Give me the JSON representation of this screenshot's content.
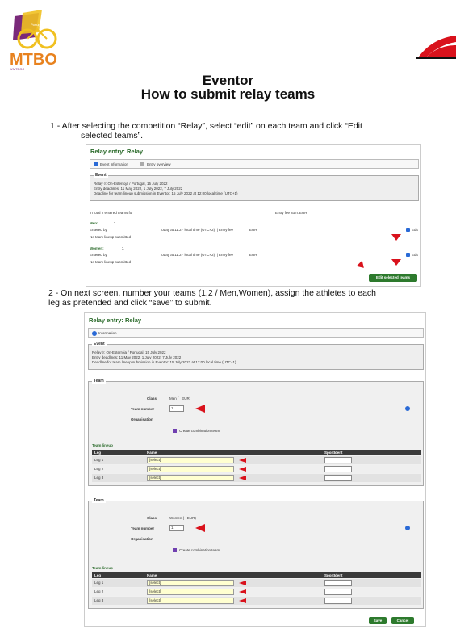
{
  "header": {
    "title": "Eventor",
    "subtitle": "How to submit relay teams"
  },
  "logo": {
    "text": "MTBO",
    "wc_text": "WMTBOC",
    "year": "2022",
    "country": "Portugal"
  },
  "step1": {
    "line1": "1 - After selecting the competition “Relay”, select “edit” on each team and click “Edit",
    "line2": "selected teams”."
  },
  "step2": {
    "line1": "2 - On next screen, number your teams (1,2 / Men,Women), assign the athletes to each",
    "line2": "leg as pretended and click “save” to submit."
  },
  "shot1": {
    "heading": "Relay entry: Relay",
    "tab1": "Event information",
    "tab2": "Entry overview",
    "event_legend": "Event",
    "event_line1": "Relay ◊: On-Esterroja / Portugal, 15 July 2022",
    "event_line2": "Entry deadlines: 11 May 2022, 1 July 2022, 7 July 2022",
    "event_line3": "Deadline for team lineup submission in Eventor: 15 July 2022 at 12:00 local time (UTC+1)",
    "total": "In total 2 entered teams for",
    "fee_sum": "Entry fee sum:",
    "eur": "EUR",
    "men_label": "Men:",
    "men_count": "1",
    "entered_by": "Entered by",
    "today": "today at 11:27 local time (UTC+2)  | Entry fee",
    "no_lineup": "No team lineup submitted",
    "women_label": "Women:",
    "women_count": "1",
    "edit": "Edit",
    "edit_selected": "Edit selected teams"
  },
  "shot2": {
    "heading": "Relay entry: Relay",
    "info_tab": "Information",
    "event_legend": "Event",
    "event_line1": "Relay ◊: On-Esterroja / Portugal, 15 July 2022",
    "event_line2": "Entry deadlines: 11 May 2022, 1 July 2022, 7 July 2022",
    "event_line3": "Deadline for team lineup submission in Eventor: 15 July 2022 at 12:00 local time (UTC+1)",
    "team_legend": "Team",
    "class_label": "Class",
    "class_men": "Men (   EUR)",
    "class_women": "Women (   EUR)",
    "team_number_label": "Team number",
    "team_number_men": "1",
    "team_number_women": "1",
    "org_label": "Organisation",
    "combo": "Create combination team",
    "lineup_title": "Team lineup",
    "col_leg": "Leg",
    "col_name": "Name",
    "col_sicard": "SportIdent",
    "legs": [
      "Leg 1",
      "Leg 2",
      "Leg 3"
    ],
    "select": "[select]",
    "save": "Save",
    "cancel": "Cancel"
  },
  "colors": {
    "accent_red": "#d9121c",
    "eventor_green": "#2d7a2d",
    "mtbo_purple": "#7a2a7a",
    "mtbo_orange": "#e8821e",
    "mtbo_yellow": "#f0c020"
  }
}
